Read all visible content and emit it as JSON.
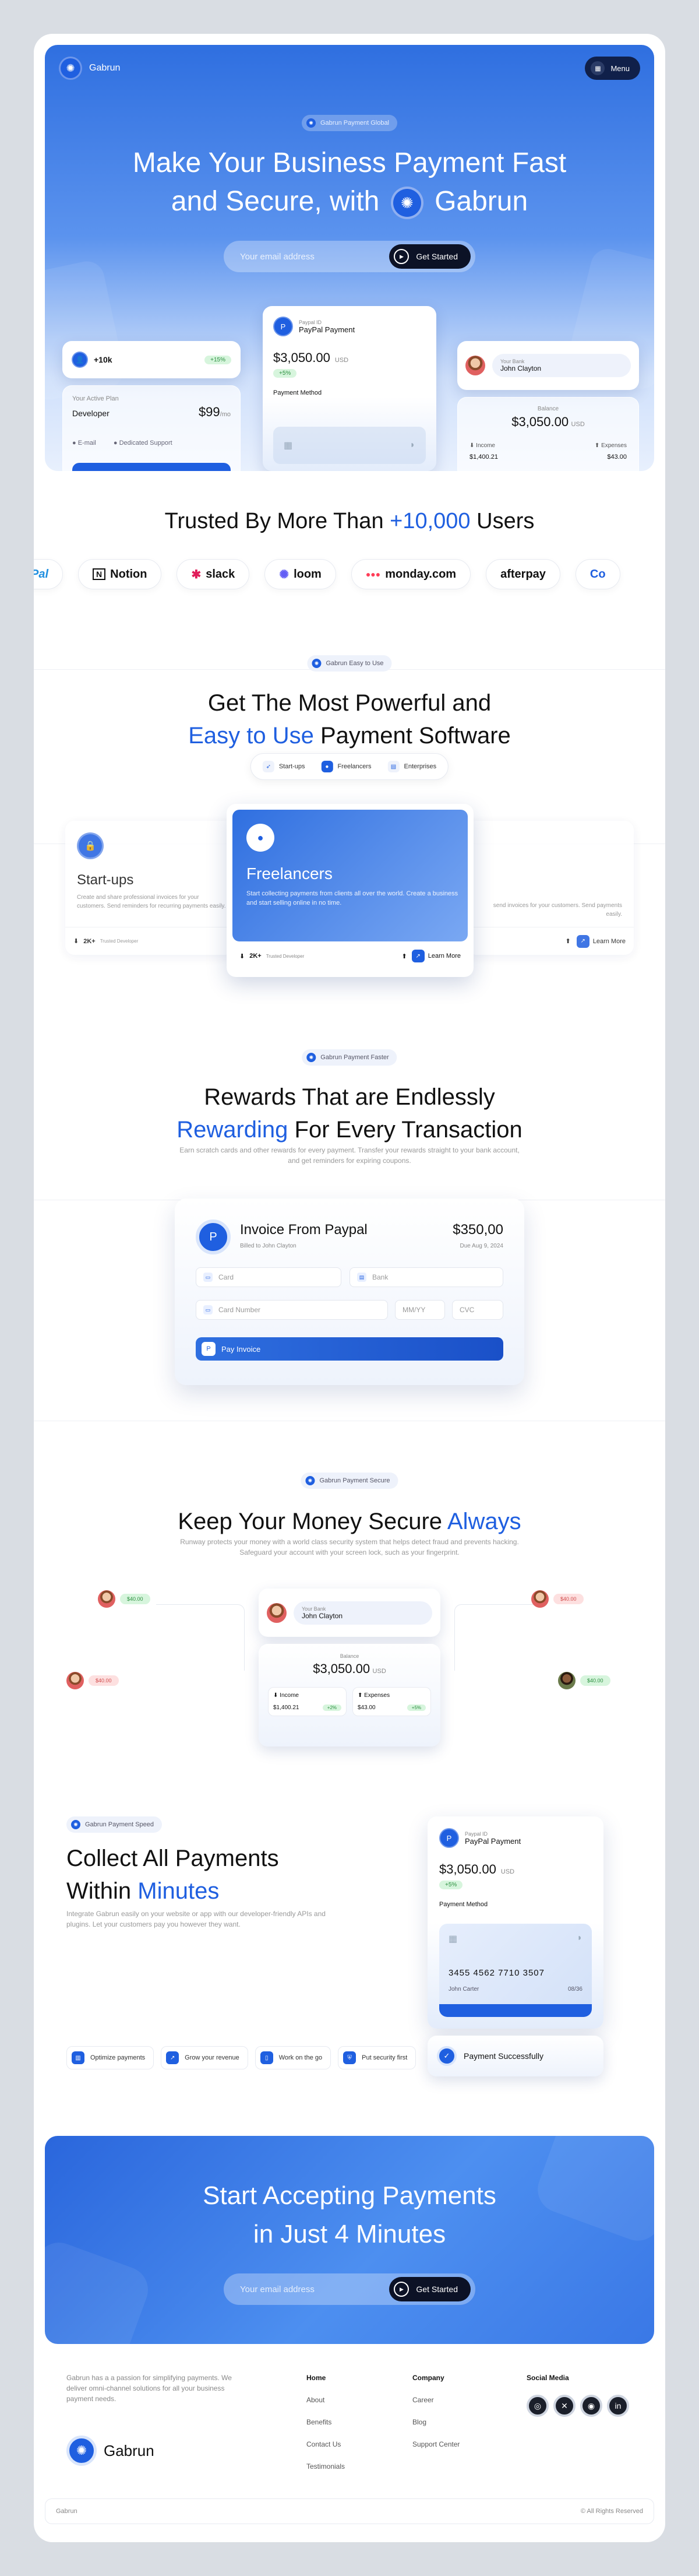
{
  "brand": {
    "name": "Gabrun",
    "accent": "#1f5fe0",
    "dark": "#0c1226"
  },
  "nav": {
    "menu_label": "Menu",
    "menu_icon": "grid-icon"
  },
  "hero": {
    "pill": "Gabrun Payment Global",
    "title_line1": "Make Your Business Payment Fast",
    "title_line2_prefix": "and Secure, with",
    "title_line2_brand": "Gabrun",
    "email_placeholder": "Your email address",
    "cta": "Get Started",
    "stat_card": {
      "value": "+10k",
      "badge": "+15%"
    },
    "plan_card": {
      "label": "Your Active Plan",
      "plan": "Developer",
      "price": "$99",
      "per": "/mo",
      "opt1": "E-mail",
      "opt2": "Dedicated Support"
    },
    "paypal_card": {
      "label": "Paypal ID",
      "name": "PayPal Payment",
      "amount": "$3,050.00",
      "currency": "USD",
      "badge": "+5%",
      "method": "Payment Method"
    },
    "user_card": {
      "label": "Your Bank",
      "name": "John Clayton"
    },
    "balance_card": {
      "label": "Balance",
      "amount": "$3,050.00",
      "currency": "USD",
      "income": "Income",
      "expenses": "Expenses",
      "income_val": "$1,400.21",
      "expenses_val": "$43.00"
    }
  },
  "trusted": {
    "title_prefix": "Trusted By More Than",
    "title_highlight": "+10,000",
    "title_suffix": "Users",
    "brands": [
      "Pal",
      "Notion",
      "slack",
      "loom",
      "monday.com",
      "afterpay",
      "Co"
    ]
  },
  "powerful": {
    "pill": "Gabrun Easy to Use",
    "title_line1": "Get The Most Powerful and",
    "title_line2_highlight": "Easy to Use",
    "title_line2_suffix": "Payment Software",
    "tabs": [
      "Start-ups",
      "Freelancers",
      "Enterprises"
    ],
    "startups": {
      "title": "Start-ups",
      "desc": "Create and share professional invoices for your customers. Send reminders for recurring payments easily.",
      "stat": "2K+",
      "stat_label": "Trusted Developer"
    },
    "freelancers": {
      "title": "Freelancers",
      "desc": "Start collecting payments from clients all over the world. Create a business and start selling online in no time.",
      "stat": "2K+",
      "stat_label": "Trusted Developer",
      "cta": "Learn More"
    },
    "enterprise": {
      "desc": "send invoices for your customers. Send payments easily.",
      "cta": "Learn More"
    }
  },
  "rewards": {
    "pill": "Gabrun Payment Faster",
    "title_line1": "Rewards That are Endlessly",
    "title_line2_highlight": "Rewarding",
    "title_line2_suffix": "For Every Transaction",
    "subtitle": "Earn scratch cards and other rewards for every payment. Transfer your rewards straight to your bank account, and get reminders for expiring coupons.",
    "invoice": {
      "title": "Invoice From Paypal",
      "billed": "Billed to John Clayton",
      "amount": "$350,00",
      "due": "Due Aug 9, 2024",
      "card": "Card",
      "bank": "Bank",
      "card_number": "Card Number",
      "mmyy": "MM/YY",
      "cvc": "CVC",
      "pay": "Pay Invoice"
    }
  },
  "secure": {
    "pill": "Gabrun Payment Secure",
    "title_prefix": "Keep Your Money Secure",
    "title_highlight": "Always",
    "subtitle": "Runway protects your money with a world class security system that helps detect fraud and prevents hacking. Safeguard your account with your screen lock, such as your fingerprint.",
    "card": {
      "bank_label": "Your Bank",
      "name": "John Clayton",
      "balance_label": "Balance",
      "amount": "$3,050.00",
      "currency": "USD",
      "income": "Income",
      "expenses": "Expenses",
      "income_val": "$1,400.21",
      "expenses_val": "$43.00",
      "income_badge": "+2%",
      "expenses_badge": "+5%"
    },
    "floats": [
      {
        "amount": "$40.00"
      },
      {
        "amount": "$40.00"
      },
      {
        "amount": "$40.00"
      },
      {
        "amount": "$40.00"
      }
    ]
  },
  "collect": {
    "pill": "Gabrun Payment Speed",
    "title_line1": "Collect All Payments",
    "title_line2_prefix": "Within",
    "title_line2_highlight": "Minutes",
    "subtitle": "Integrate Gabrun easily on your website or app with our developer-friendly APIs and plugins. Let your customers pay you however they want.",
    "features": [
      "Optimize payments",
      "Grow your revenue",
      "Work on the go",
      "Put security first"
    ],
    "card": {
      "label": "Paypal ID",
      "name": "PayPal Payment",
      "amount": "$3,050.00",
      "currency": "USD",
      "badge": "+5%",
      "method": "Payment Method",
      "number": "3455 4562 7710 3507",
      "holder": "John Carter",
      "expiry": "08/36"
    },
    "success": "Payment Successfully"
  },
  "cta": {
    "title_line1": "Start Accepting Payments",
    "title_line2": "in Just 4 Minutes",
    "email_placeholder": "Your email address",
    "button": "Get Started"
  },
  "footer": {
    "about": "Gabrun has a a passion for simplifying payments. We deliver omni-channel solutions for all your business payment needs.",
    "brand": "Gabrun",
    "col1": [
      "Home",
      "About",
      "Benefits",
      "Contact Us",
      "Testimonials"
    ],
    "col2": [
      "Company",
      "Career",
      "Blog",
      "Support Center"
    ],
    "social_title": "Social Media",
    "social_icons": [
      "dribbble-icon",
      "x-icon",
      "instagram-icon",
      "linkedin-icon"
    ],
    "bottom_left": "Gabrun",
    "bottom_right": "© All Rights Reserved"
  }
}
